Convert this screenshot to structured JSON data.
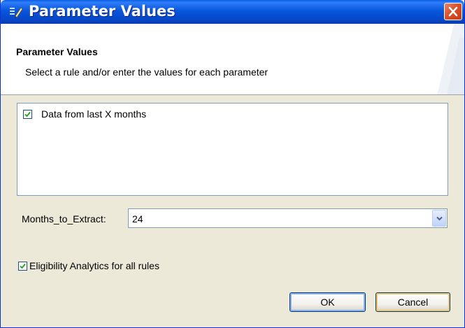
{
  "window": {
    "title": "Parameter Values",
    "title_icon": "parameters-icon",
    "close_icon": "close-icon"
  },
  "header": {
    "title": "Parameter Values",
    "description": "Select a rule and/or enter the values for each parameter"
  },
  "rules": [
    {
      "label": "Data from last X months",
      "checked": true
    }
  ],
  "parameter": {
    "label": "Months_to_Extract:",
    "value": "24"
  },
  "eligibility": {
    "label": "Eligibility Analytics for all rules",
    "checked": true
  },
  "buttons": {
    "ok": "OK",
    "cancel": "Cancel"
  },
  "colors": {
    "titlebar": "#0856dd",
    "close_button": "#d9512b",
    "dialog_background": "#ece9d8",
    "input_border": "#7f9db9"
  }
}
